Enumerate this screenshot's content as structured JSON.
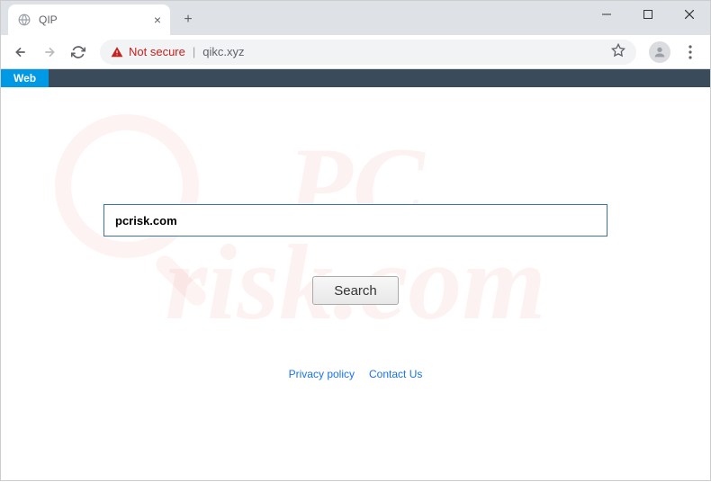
{
  "window": {
    "tab_title": "QIP"
  },
  "toolbar": {
    "security_label": "Not secure",
    "url": "qikc.xyz"
  },
  "nav": {
    "web_label": "Web"
  },
  "search": {
    "value": "pcrisk.com",
    "button_label": "Search"
  },
  "footer": {
    "privacy": "Privacy policy",
    "contact": "Contact Us"
  },
  "watermark": {
    "line1": "PC",
    "line2": "risk.com"
  }
}
